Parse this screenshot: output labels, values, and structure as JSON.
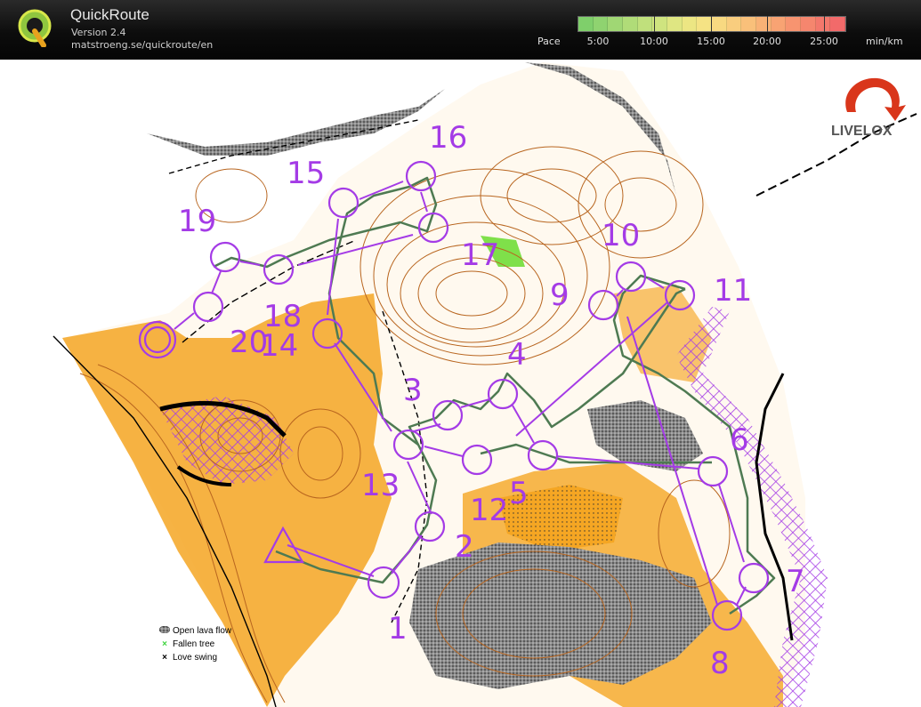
{
  "app": {
    "title": "QuickRoute",
    "version": "Version 2.4",
    "url": "matstroeng.se/quickroute/en"
  },
  "pace": {
    "label": "Pace",
    "unit": "min/km",
    "ticks": [
      "5:00",
      "10:00",
      "15:00",
      "20:00",
      "25:00"
    ]
  },
  "brand": {
    "livelox": "LIVELOX"
  },
  "legend": [
    {
      "symbol": "lava-icon",
      "label": "Open lava flow"
    },
    {
      "symbol": "fallen-tree-icon",
      "label": "Fallen tree"
    },
    {
      "symbol": "love-swing-icon",
      "label": "Love swing"
    }
  ],
  "controls": [
    "1",
    "2",
    "3",
    "4",
    "5",
    "6",
    "7",
    "8",
    "9",
    "10",
    "11",
    "12",
    "13",
    "14",
    "15",
    "16",
    "17",
    "18",
    "19",
    "20"
  ],
  "colors": {
    "course": "#a43be6",
    "route": "#5a8a5a",
    "open_land": "#f5a623",
    "contour": "#b8651f",
    "lava": "#777777"
  }
}
